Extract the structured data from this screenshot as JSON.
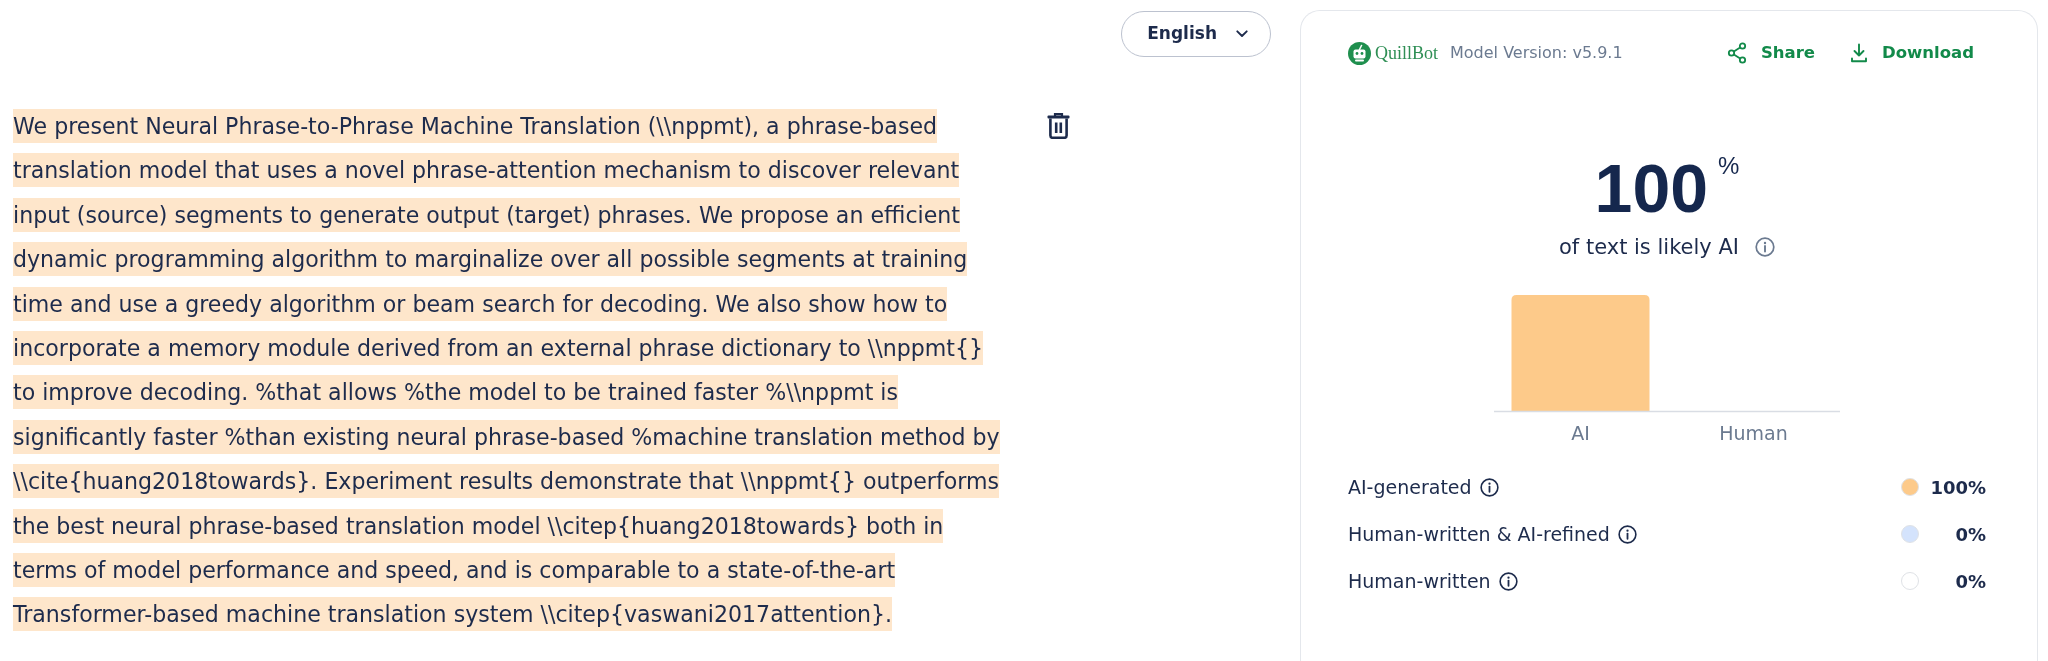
{
  "language_selector": {
    "label": "English"
  },
  "document": {
    "text": "We present Neural Phrase-to-Phrase Machine Translation (\\\\nppmt), a phrase-based translation model that uses a novel phrase-attention mechanism to discover relevant input (source) segments to generate output (target) phrases. We propose an efficient dynamic programming algorithm to marginalize over all possible segments at training time and use a greedy algorithm or beam search for decoding. We also show how to incorporate a memory module derived from an external phrase dictionary to \\\\nppmt{} to improve decoding. %that allows %the model to be trained faster %\\\\nppmt is significantly faster %than existing neural phrase-based %machine translation method by \\\\cite{huang2018towards}. Experiment results demonstrate that \\\\nppmt{} outperforms the best neural phrase-based translation model \\\\citep{huang2018towards} both in terms of model performance and speed, and is comparable to a state-of-the-art Transformer-based machine translation system \\\\citep{vaswani2017attention}.",
    "highlighted": true
  },
  "report": {
    "brand": "QuillBot",
    "model_version": "Model Version: v5.9.1",
    "actions": [
      {
        "kind": "share",
        "label": "Share"
      },
      {
        "kind": "download",
        "label": "Download"
      }
    ],
    "score": {
      "value": "100",
      "unit": "%",
      "caption": "of text is likely AI"
    },
    "bar_chart": {
      "bars": [
        {
          "label": "AI",
          "level": 1
        },
        {
          "label": "Human"
        }
      ]
    },
    "breakdown": [
      {
        "label": "AI-generated",
        "color": "#fdca8a",
        "value": "100%"
      },
      {
        "label": "Human-written & AI-refined",
        "color": "#d4e3fc",
        "value": "0%"
      },
      {
        "label": "Human-written",
        "color": "#ffffff",
        "value": "0%"
      }
    ]
  }
}
